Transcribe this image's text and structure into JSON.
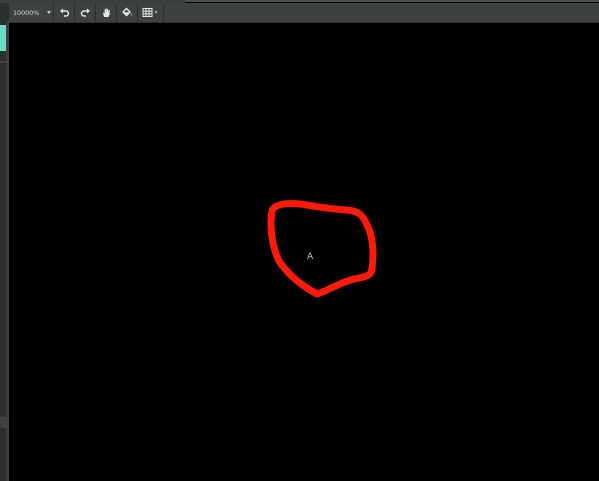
{
  "toolbar": {
    "zoom_value": "10000%",
    "buttons": [
      {
        "name": "undo-button",
        "icon": "undo-icon"
      },
      {
        "name": "redo-button",
        "icon": "redo-icon"
      },
      {
        "name": "pan-button",
        "icon": "hand-icon"
      },
      {
        "name": "fill-button",
        "icon": "paint-bucket-icon"
      },
      {
        "name": "grid-button",
        "icon": "grid-icon"
      }
    ]
  },
  "canvas": {
    "label": "A",
    "annotation_color": "#ff1a0a"
  },
  "colors": {
    "background": "#000000",
    "toolbar": "#3c4241",
    "accent": "#67e0c0"
  }
}
